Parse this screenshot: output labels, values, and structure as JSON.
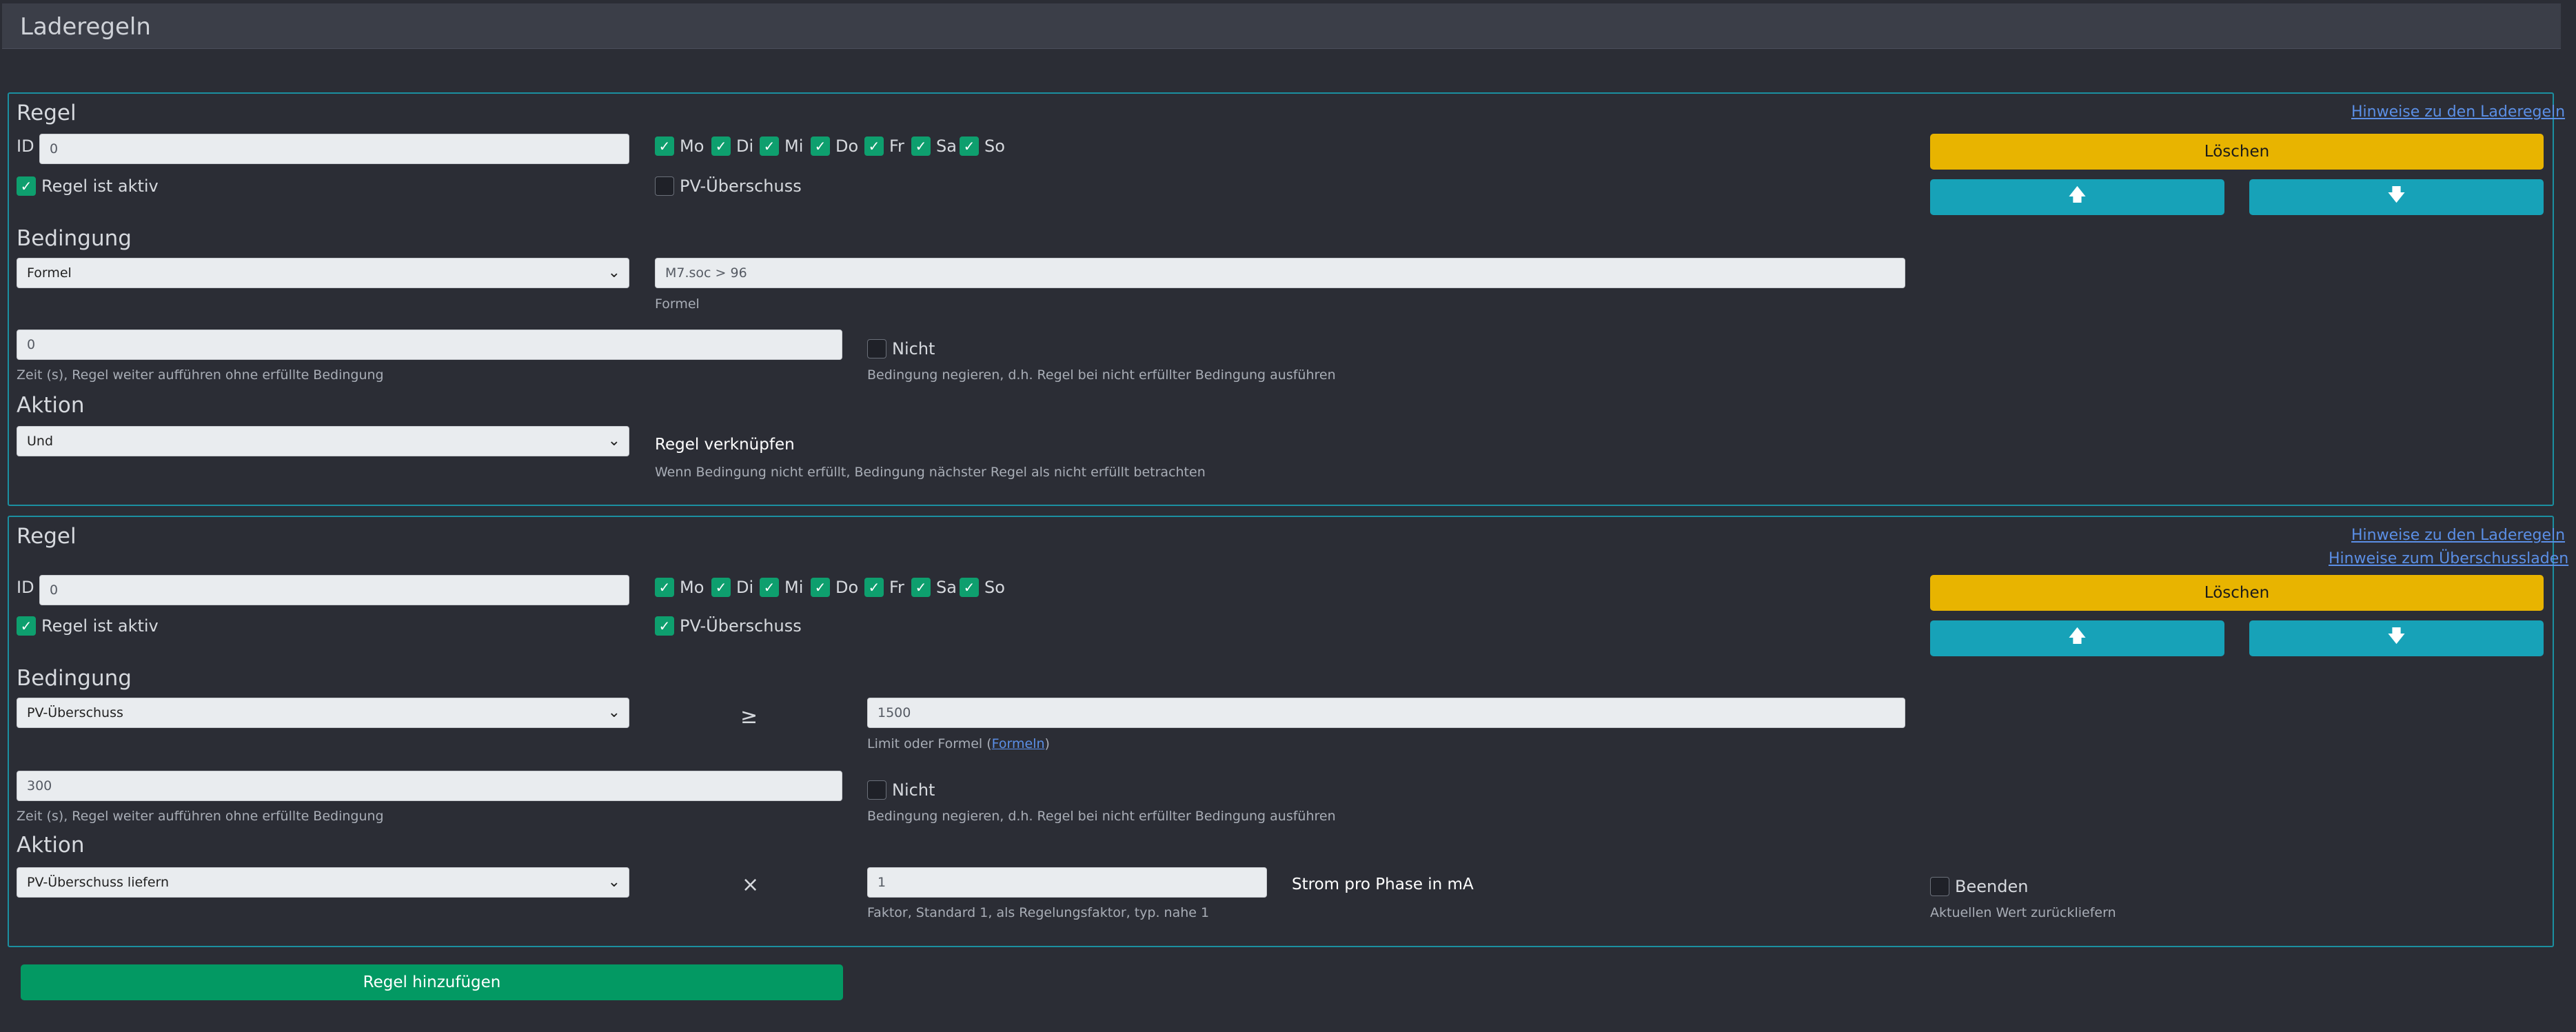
{
  "page": {
    "title": "Laderegeln"
  },
  "icons": {
    "check": "check-icon",
    "chevron": "chevron-down-icon",
    "up": "arrow-up-icon",
    "down": "arrow-down-icon"
  },
  "days": [
    "Mo",
    "Di",
    "Mi",
    "Do",
    "Fr",
    "Sa",
    "So"
  ],
  "common": {
    "rule_title": "Regel",
    "id_label": "ID",
    "active_label": "Regel ist aktiv",
    "pv_label": "PV-Überschuss",
    "condition_title": "Bedingung",
    "action_title": "Aktion",
    "delete_label": "Löschen",
    "up_glyph": "🡅",
    "down_glyph": "🡇",
    "hint_rules": "Hinweise zu den Laderegeln",
    "hint_surplus": "Hinweise zum Überschussladen",
    "time_help": "Zeit (s), Regel weiter aufführen ohne erfüllte Bedingung",
    "not_label": "Nicht",
    "not_help": "Bedingung negieren, d.h. Regel bei nicht erfüllter Bedingung ausführen"
  },
  "rule1": {
    "id": "0",
    "condition_type": "Formel",
    "formula": "M7.soc > 96",
    "formula_help": "Formel",
    "time": "0",
    "action_type": "Und",
    "link_label": "Regel verknüpfen",
    "link_help": "Wenn Bedingung nicht erfüllt, Bedingung nächster Regel als nicht erfüllt betrachten"
  },
  "rule2": {
    "id": "0",
    "condition_type": "PV-Überschuss",
    "operator": "≥",
    "limit": "1500",
    "limit_help_prefix": "Limit oder Formel (",
    "limit_help_link": "Formeln",
    "limit_help_suffix": ")",
    "time": "300",
    "action_type": "PV-Überschuss liefern",
    "multiply": "×",
    "factor": "1",
    "unit_label": "Strom pro Phase in mA",
    "factor_help": "Faktor, Standard 1, als Regelungsfaktor, typ. nahe 1",
    "end_label": "Beenden",
    "end_help": "Aktuellen Wert zurückliefern"
  },
  "footer": {
    "add_rule": "Regel hinzufügen"
  }
}
